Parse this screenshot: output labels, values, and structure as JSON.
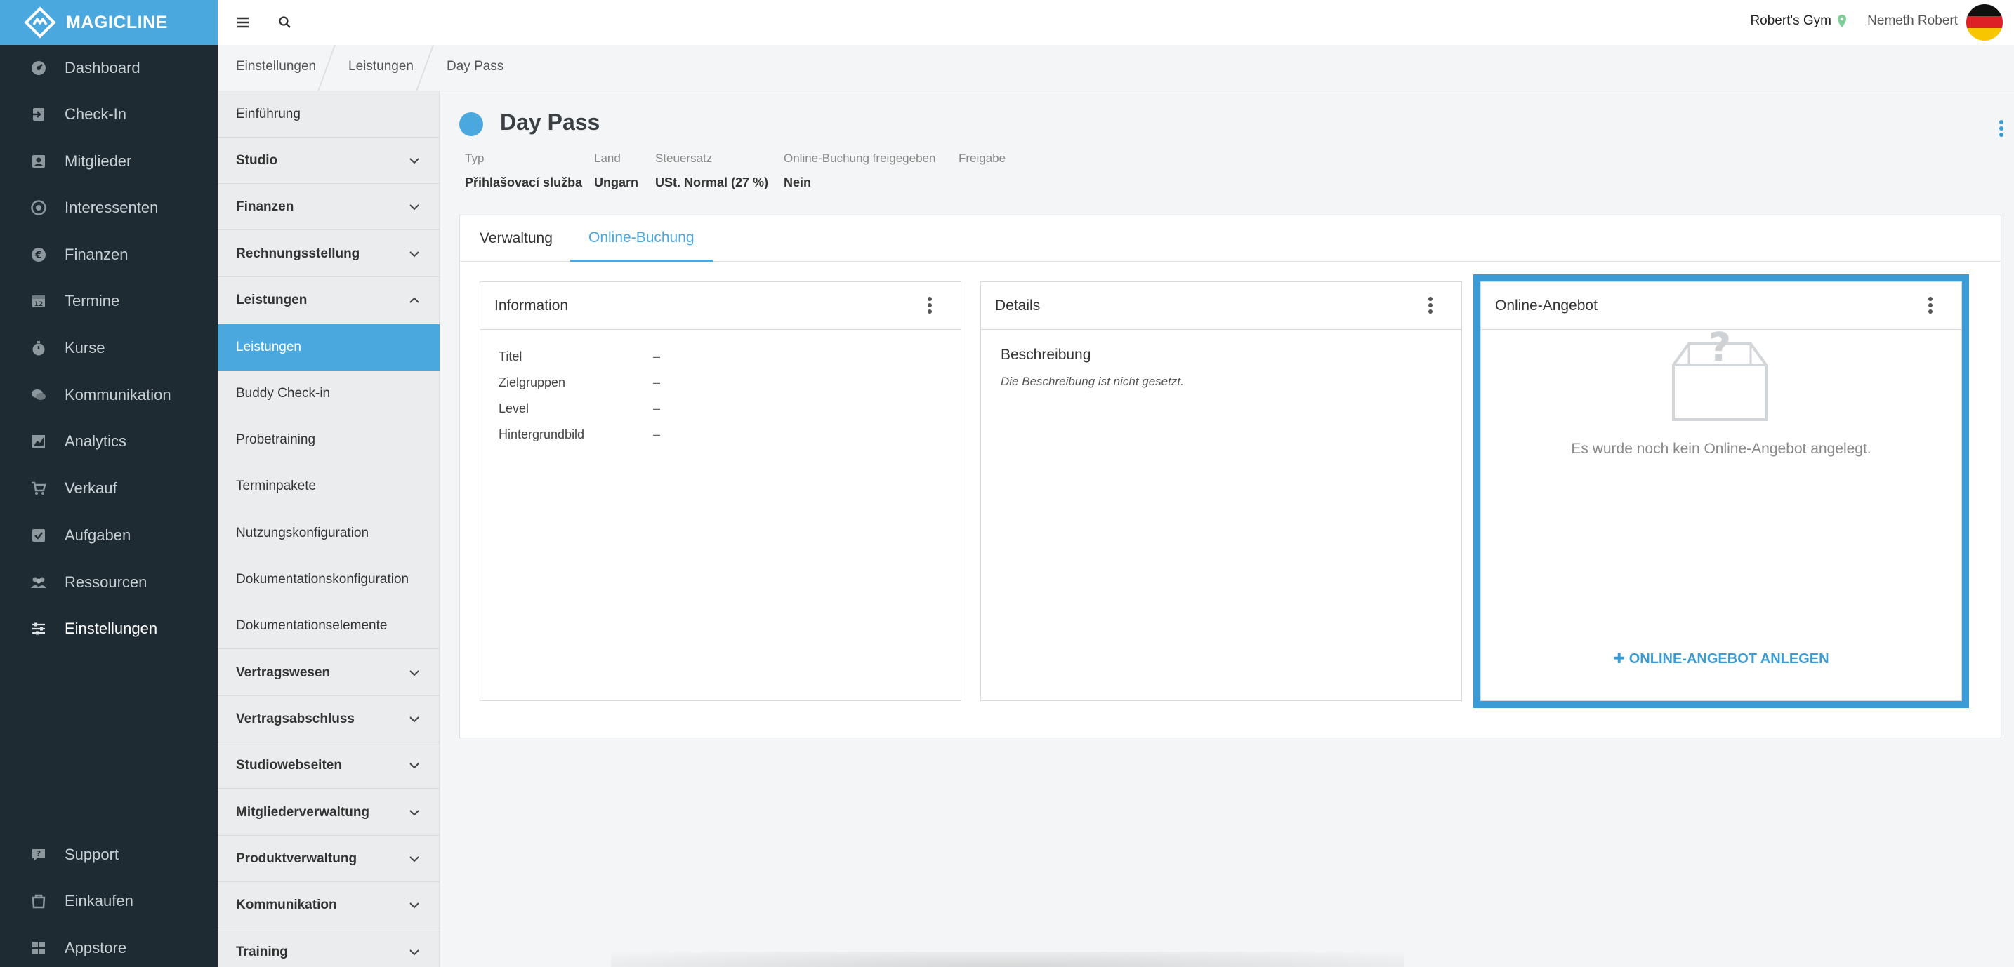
{
  "brand": {
    "name": "MAGICLINE"
  },
  "nav": {
    "items": [
      {
        "label": "Dashboard",
        "icon": "dashboard-icon"
      },
      {
        "label": "Check-In",
        "icon": "checkin-icon"
      },
      {
        "label": "Mitglieder",
        "icon": "members-icon"
      },
      {
        "label": "Interessenten",
        "icon": "target-icon"
      },
      {
        "label": "Finanzen",
        "icon": "euro-icon"
      },
      {
        "label": "Termine",
        "icon": "calendar-icon"
      },
      {
        "label": "Kurse",
        "icon": "stopwatch-icon"
      },
      {
        "label": "Kommunikation",
        "icon": "chat-icon"
      },
      {
        "label": "Analytics",
        "icon": "chart-icon"
      },
      {
        "label": "Verkauf",
        "icon": "cart-icon"
      },
      {
        "label": "Aufgaben",
        "icon": "checkbox-icon"
      },
      {
        "label": "Ressourcen",
        "icon": "people-icon"
      },
      {
        "label": "Einstellungen",
        "icon": "sliders-icon"
      }
    ],
    "bottom": [
      {
        "label": "Support",
        "icon": "support-icon"
      },
      {
        "label": "Einkaufen",
        "icon": "shop-icon"
      },
      {
        "label": "Appstore",
        "icon": "grid-icon"
      }
    ]
  },
  "topbar": {
    "gym": "Robert's Gym",
    "user": "Nemeth Robert"
  },
  "breadcrumb": [
    "Einstellungen",
    "Leistungen",
    "Day Pass"
  ],
  "settings": {
    "intro": "Einführung",
    "sections_top": [
      "Studio",
      "Finanzen",
      "Rechnungsstellung"
    ],
    "open_section": "Leistungen",
    "sub_items": [
      "Leistungen",
      "Buddy Check-in",
      "Probetraining",
      "Terminpakete",
      "Nutzungskonfiguration",
      "Dokumentationskonfiguration",
      "Dokumentationselemente"
    ],
    "sections_bottom": [
      "Vertragswesen",
      "Vertragsabschluss",
      "Studiowebseiten",
      "Mitgliederverwaltung",
      "Produktverwaltung",
      "Kommunikation",
      "Training"
    ]
  },
  "page": {
    "title": "Day Pass",
    "meta": [
      {
        "label": "Typ",
        "value": "Přihlašovací služba"
      },
      {
        "label": "Land",
        "value": "Ungarn"
      },
      {
        "label": "Steuersatz",
        "value": "USt. Normal (27 %)"
      },
      {
        "label": "Online-Buchung freigegeben",
        "value": "Nein"
      },
      {
        "label": "Freigabe",
        "value": ""
      }
    ],
    "tabs": [
      "Verwaltung",
      "Online-Buchung"
    ],
    "info_card": {
      "title": "Information",
      "rows": [
        {
          "label": "Titel",
          "value": "–"
        },
        {
          "label": "Zielgruppen",
          "value": "–"
        },
        {
          "label": "Level",
          "value": "–"
        },
        {
          "label": "Hintergrundbild",
          "value": "–"
        }
      ]
    },
    "details_card": {
      "title": "Details",
      "subtitle": "Beschreibung",
      "text": "Die Beschreibung ist nicht gesetzt."
    },
    "offer_card": {
      "title": "Online-Angebot",
      "empty": "Es wurde noch kein Online-Angebot angelegt.",
      "button": "ONLINE-ANGEBOT ANLEGEN"
    }
  },
  "colors": {
    "accent": "#4aa8de",
    "nav_bg": "#1e2b33",
    "highlight": "#3a9bd5"
  }
}
